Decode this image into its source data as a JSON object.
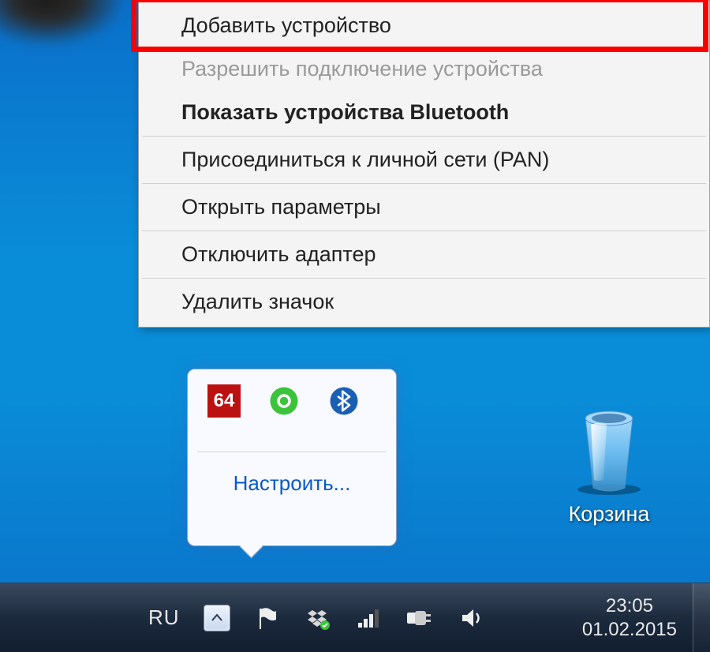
{
  "context_menu": {
    "items": [
      {
        "label": "Добавить устройство",
        "state": "highlighted"
      },
      {
        "label": "Разрешить подключение устройства",
        "state": "disabled"
      },
      {
        "label": "Показать устройства Bluetooth",
        "state": "bold"
      },
      {
        "sep": true
      },
      {
        "label": "Присоединиться к личной сети (PAN)",
        "state": "normal"
      },
      {
        "sep": true
      },
      {
        "label": "Открыть параметры",
        "state": "normal"
      },
      {
        "sep": true
      },
      {
        "label": "Отключить адаптер",
        "state": "normal"
      },
      {
        "sep": true
      },
      {
        "label": "Удалить значок",
        "state": "normal"
      }
    ]
  },
  "tray_popout": {
    "icons": [
      {
        "name": "avira-64-icon",
        "text": "64"
      },
      {
        "name": "skype-icon"
      },
      {
        "name": "bluetooth-icon"
      }
    ],
    "customize_label": "Настроить..."
  },
  "desktop": {
    "recycle_bin_label": "Корзина"
  },
  "taskbar": {
    "language": "RU",
    "time": "23:05",
    "date": "01.02.2015",
    "tray_icons": [
      "show-hidden-icons-chevron",
      "action-center-flag-icon",
      "dropbox-icon",
      "network-signal-icon",
      "power-plug-icon",
      "volume-icon"
    ]
  },
  "colors": {
    "highlight": "#fb0000",
    "desktop_bg": "#0a8dd8",
    "taskbar_bg": "#1c2a3d"
  }
}
